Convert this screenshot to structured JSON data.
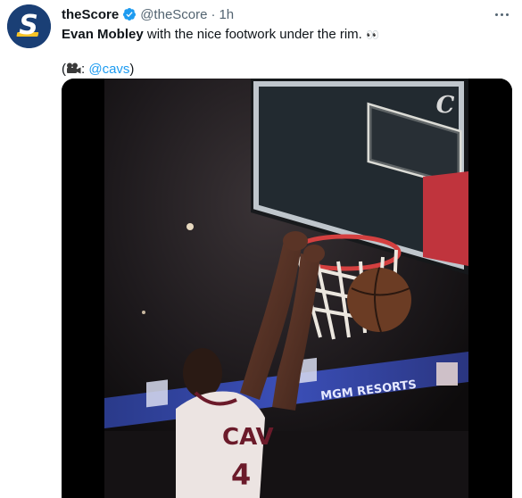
{
  "tweet": {
    "display_name": "theScore",
    "handle": "@theScore",
    "separator": "·",
    "time": "1h",
    "text_mention": "Evan Mobley",
    "text_rest": " with the nice footwork under the rim.",
    "text_emoji": "👀",
    "credit_open": "(",
    "credit_colon": ": ",
    "credit_link": "@cavs",
    "credit_close": ")"
  },
  "video": {
    "jersey_text": "CAV",
    "jersey_number": "4",
    "banner_text": "MGM RESORTS",
    "logo_letter": "C"
  },
  "colors": {
    "brand_blue": "#1d9bf0",
    "secondary_text": "#536471",
    "avatar_bg": "#1a3f75",
    "avatar_accent": "#f6c326"
  },
  "icons": [
    "avatar-logo",
    "verified-badge-icon",
    "more-options-icon",
    "video-camera-icon"
  ]
}
